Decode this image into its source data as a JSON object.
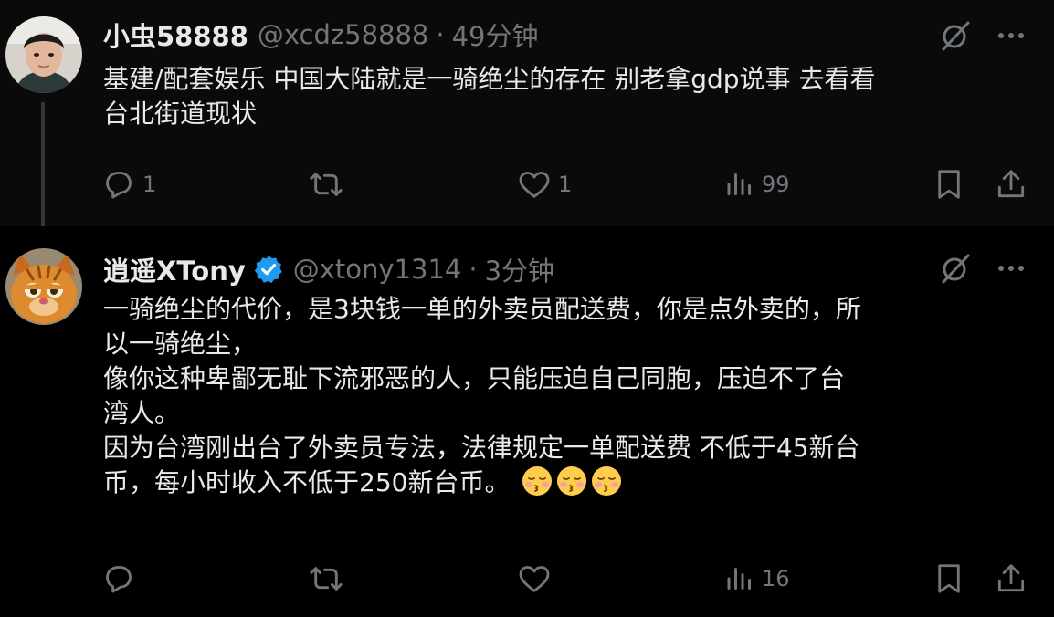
{
  "tweets": [
    {
      "display_name": "小虫58888",
      "handle": "@xcdz58888",
      "separator": "·",
      "time": "49分钟",
      "verified": false,
      "body_lines": [
        "基建/配套娱乐 中国大陆就是一骑绝尘的存在 别老拿gdp说事 去看看",
        "台北街道现状"
      ],
      "stats": {
        "replies": "1",
        "retweets": "",
        "likes": "1",
        "views": "99"
      }
    },
    {
      "display_name": "逍遥XTony",
      "handle": "@xtony1314",
      "separator": "·",
      "time": "3分钟",
      "verified": true,
      "body_lines": [
        "一骑绝尘的代价，是3块钱一单的外卖员配送费，你是点外卖的，所",
        "以一骑绝尘，",
        "像你这种卑鄙无耻下流邪恶的人，只能压迫自己同胞，压迫不了台",
        "湾人。",
        "因为台湾刚出台了外卖员专法，法律规定一单配送费 不低于45新台",
        "币，每小时收入不低于250新台币。"
      ],
      "emojis": [
        "kissing-face-with-closed-eyes",
        "kissing-face-with-closed-eyes",
        "kissing-face-with-closed-eyes"
      ],
      "stats": {
        "replies": "",
        "retweets": "",
        "likes": "",
        "views": "16"
      }
    }
  ],
  "colors": {
    "background": "#000000",
    "text": "#e7e9ea",
    "muted": "#71767b",
    "verified": "#1d9bf0",
    "thread_line": "#333639"
  },
  "icons": {
    "reply": "reply-icon",
    "retweet": "retweet-icon",
    "like": "heart-icon",
    "views": "views-icon",
    "bookmark": "bookmark-icon",
    "share": "share-icon",
    "grok": "grok-icon",
    "more": "more-icon",
    "verified": "verified-badge-icon"
  }
}
